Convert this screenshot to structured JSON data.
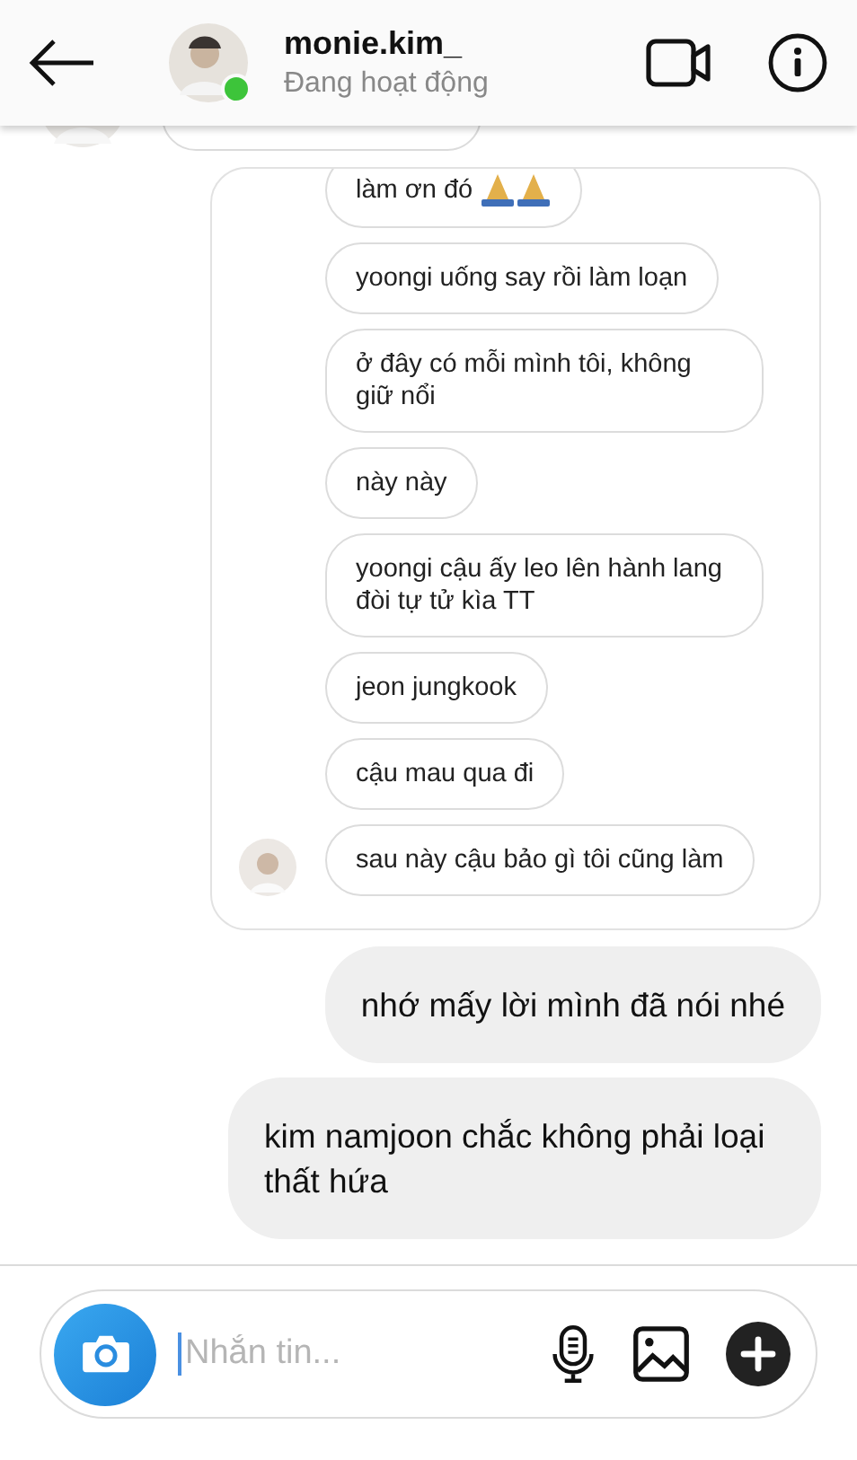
{
  "header": {
    "username": "monie.kim_",
    "status": "Đang hoạt động",
    "online": true
  },
  "shared_screenshot": {
    "messages": [
      {
        "text": "làm ơn đó",
        "kind": "with-prayer-icons"
      },
      {
        "text": "yoongi uống say rồi làm loạn",
        "kind": "text"
      },
      {
        "text": "ở đây có mỗi mình tôi, không giữ nổi",
        "kind": "text"
      },
      {
        "text": "này này",
        "kind": "text"
      },
      {
        "text": "yoongi cậu ấy leo lên hành lang đòi tự tử kìa TT",
        "kind": "text"
      },
      {
        "text": "jeon jungkook",
        "kind": "text"
      },
      {
        "text": "cậu mau qua đi",
        "kind": "text"
      },
      {
        "text": "sau này cậu bảo gì tôi cũng làm",
        "kind": "text"
      }
    ]
  },
  "sent_messages": [
    {
      "text": "nhớ mấy lời mình đã nói nhé"
    },
    {
      "text": "kim namjoon chắc không phải loại thất hứa"
    }
  ],
  "composer": {
    "placeholder": "Nhắn tin..."
  }
}
